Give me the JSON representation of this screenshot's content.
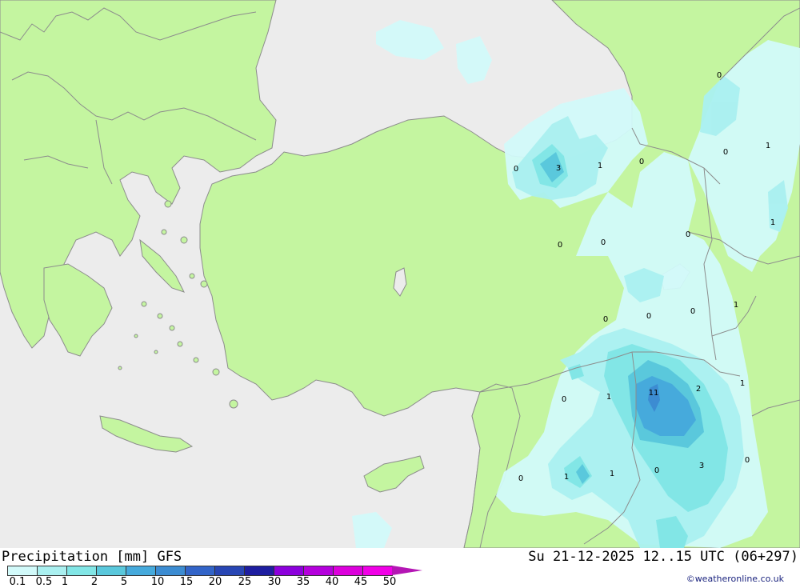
{
  "header": {
    "title": "Precipitation [mm] GFS",
    "datetime": "Su 21-12-2025 12..15 UTC (06+297)"
  },
  "credit": "©weatheronline.co.uk",
  "legend": {
    "colors": [
      "#d2fafa",
      "#aaf0f0",
      "#82e6e6",
      "#5ac8dc",
      "#46aadc",
      "#3c8cd2",
      "#3264c8",
      "#2846b4",
      "#1e1ea0",
      "#8c00dc",
      "#b400dc",
      "#dc00dc",
      "#f000e6",
      "#b416b4"
    ],
    "labels": [
      "0.1",
      "0.5",
      "1",
      "2",
      "5",
      "10",
      "15",
      "20",
      "25",
      "30",
      "35",
      "40",
      "45",
      "50"
    ]
  },
  "map": {
    "colors": {
      "sea": "#ececec",
      "land": "#c4f5a0",
      "border": "#8c8c8c"
    },
    "values": [
      "0",
      "3",
      "1",
      "0",
      "0",
      "0",
      "1",
      "0",
      "0",
      "0",
      "0",
      "0",
      "0",
      "1",
      "0",
      "1",
      "11",
      "2",
      "1",
      "0",
      "1",
      "1",
      "0",
      "3",
      "0",
      "1"
    ]
  }
}
